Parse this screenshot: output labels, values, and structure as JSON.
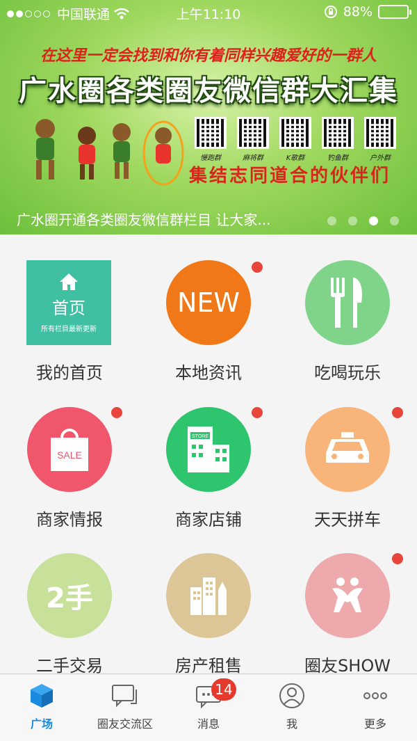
{
  "status_bar": {
    "carrier": "中国联通",
    "time": "上午11:10",
    "battery": "88%",
    "battery_level": 0.88
  },
  "banner": {
    "tagline": "在这里一定会找到和你有着同样兴趣爱好的一群人",
    "title": "广水圈各类圈友微信群大汇集",
    "qr_captions": [
      "慢跑群",
      "麻将群",
      "K歌群",
      "钓鱼群",
      "户外群"
    ],
    "slogan": "集结志同道合的伙伴们",
    "caption": "广水圈开通各类圈友微信群栏目 让大家...",
    "pager": {
      "count": 4,
      "active_index": 2
    }
  },
  "grid": {
    "items": [
      {
        "label": "我的首页",
        "icon": "home-tile",
        "tile_title": "首页",
        "tile_sub": "所有栏目最新更新",
        "color": "#3fc0a3",
        "badge": false
      },
      {
        "label": "本地资讯",
        "icon": "new-icon",
        "icon_text": "NEW",
        "color": "#f07818",
        "badge": true
      },
      {
        "label": "吃喝玩乐",
        "icon": "fork-knife-icon",
        "color": "#7fd48a",
        "badge": false
      },
      {
        "label": "商家情报",
        "icon": "sale-bag-icon",
        "icon_text": "SALE",
        "color": "#f0566c",
        "badge": true
      },
      {
        "label": "商家店铺",
        "icon": "store-icon",
        "icon_text": "STORE",
        "color": "#2fc56e",
        "badge": true
      },
      {
        "label": "天天拼车",
        "icon": "taxi-icon",
        "color": "#f9b47a",
        "badge": true
      },
      {
        "label": "二手交易",
        "icon": "second-hand-icon",
        "icon_text": "2手",
        "color": "#c7e09a",
        "badge": false
      },
      {
        "label": "房产租售",
        "icon": "buildings-icon",
        "color": "#dcc596",
        "badge": false
      },
      {
        "label": "圈友SHOW",
        "icon": "dancing-people-icon",
        "color": "#eea9ac",
        "badge": true
      }
    ]
  },
  "tabbar": {
    "tabs": [
      {
        "label": "广场",
        "icon": "cube-icon",
        "active": true
      },
      {
        "label": "圈友交流区",
        "icon": "chat-bubbles-icon",
        "active": false
      },
      {
        "label": "消息",
        "icon": "message-icon",
        "active": false,
        "badge": "14"
      },
      {
        "label": "我",
        "icon": "person-icon",
        "active": false
      },
      {
        "label": "更多",
        "icon": "more-dots-icon",
        "active": false
      }
    ]
  },
  "colors": {
    "accent": "#1a8be0",
    "badge_red": "#e8453c"
  }
}
